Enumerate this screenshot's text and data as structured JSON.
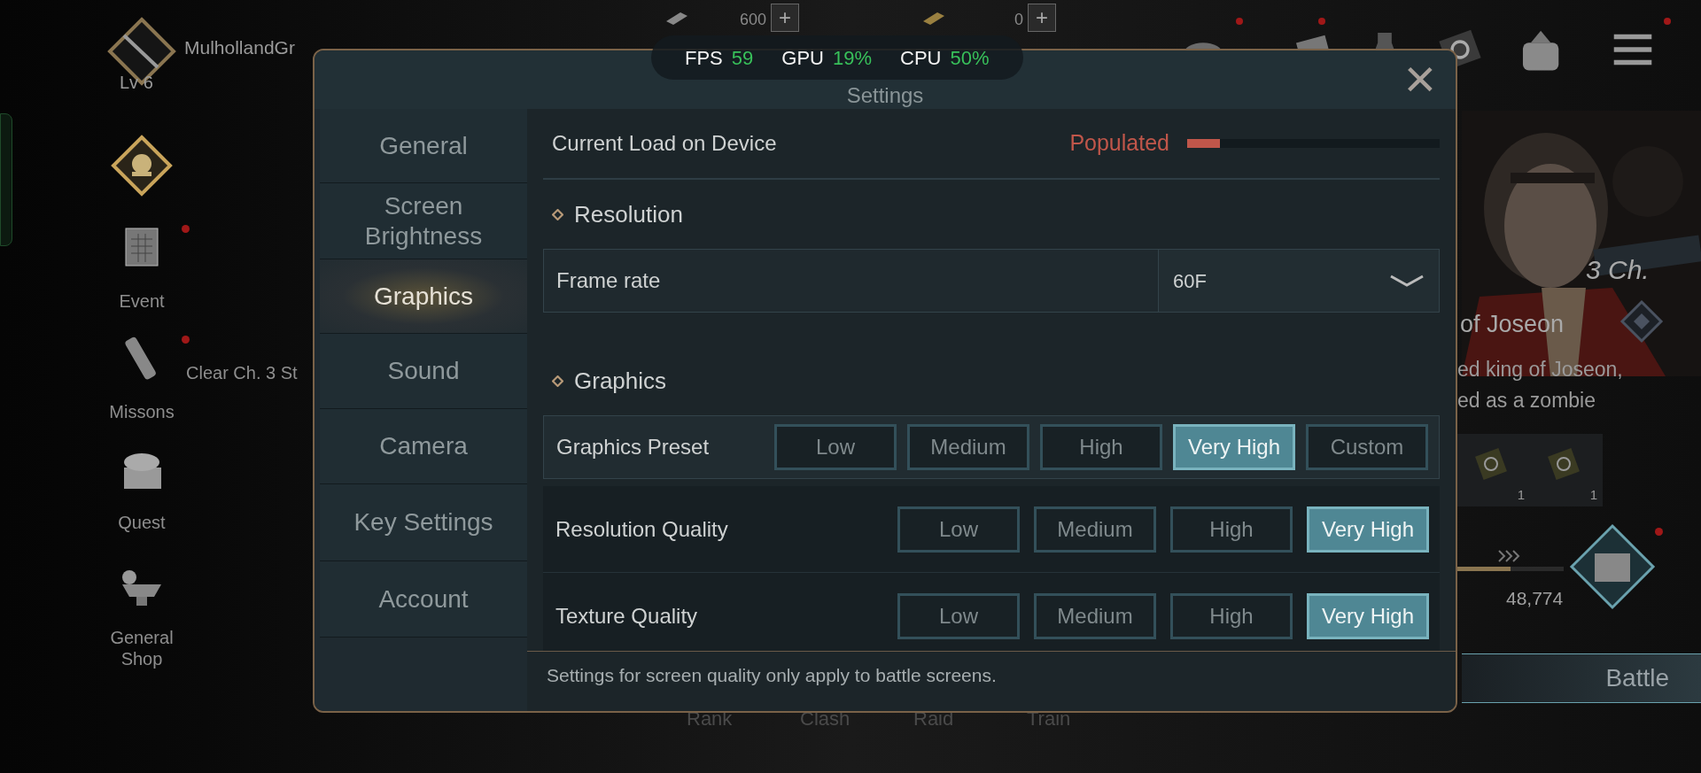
{
  "hud": {
    "player_name": "MulhollandGr",
    "level": "Lv 6",
    "resources": [
      {
        "amount": "600",
        "plus": "+"
      },
      {
        "amount": "0",
        "plus": "+"
      }
    ]
  },
  "side_menu": [
    {
      "label": "Event",
      "alert": true
    },
    {
      "label": "Missons",
      "alert": true
    },
    {
      "label": "Quest",
      "alert": false
    },
    {
      "label": "General\nShop",
      "alert": false
    }
  ],
  "quest_hint": "Clear Ch. 3 St",
  "perf": [
    {
      "label": "FPS",
      "value": "59"
    },
    {
      "label": "GPU",
      "value": "19%"
    },
    {
      "label": "CPU",
      "value": "50%"
    }
  ],
  "settings": {
    "title": "Settings",
    "close": "×",
    "nav": [
      {
        "label": "General",
        "selected": false
      },
      {
        "label": "Screen Brightness",
        "selected": false
      },
      {
        "label": "Graphics",
        "selected": true
      },
      {
        "label": "Sound",
        "selected": false
      },
      {
        "label": "Camera",
        "selected": false
      },
      {
        "label": "Key Settings",
        "selected": false
      },
      {
        "label": "Account",
        "selected": false
      }
    ],
    "load": {
      "label": "Current Load on Device",
      "status": "Populated",
      "level": 0.13
    },
    "sections": [
      {
        "kind": "heading",
        "label": "Resolution"
      },
      {
        "kind": "dropdown",
        "label": "Frame rate",
        "value": "60F"
      },
      {
        "kind": "heading",
        "label": "Graphics"
      },
      {
        "kind": "preset",
        "label": "Graphics Preset",
        "options": [
          {
            "label": "Low",
            "selected": false
          },
          {
            "label": "Medium",
            "selected": false
          },
          {
            "label": "High",
            "selected": false
          },
          {
            "label": "Very High",
            "selected": true
          },
          {
            "label": "Custom",
            "selected": false
          }
        ]
      },
      {
        "kind": "quality",
        "label": "Resolution Quality",
        "options": [
          {
            "label": "Low",
            "selected": false
          },
          {
            "label": "Medium",
            "selected": false
          },
          {
            "label": "High",
            "selected": false
          },
          {
            "label": "Very High",
            "selected": true
          }
        ]
      },
      {
        "kind": "quality",
        "label": "Texture Quality",
        "options": [
          {
            "label": "Low",
            "selected": false
          },
          {
            "label": "Medium",
            "selected": false
          },
          {
            "label": "High",
            "selected": false
          },
          {
            "label": "Very High",
            "selected": true
          }
        ]
      }
    ],
    "footer_note": "Settings for screen quality only apply to battle screens."
  },
  "background": {
    "chapter": "3 Ch.",
    "boss_name": "of Joseon",
    "boss_desc": [
      "ed king of Joseon,",
      "ed as a zombie"
    ],
    "rewards": [
      {
        "count": "1"
      },
      {
        "count": "1"
      }
    ],
    "progress": {
      "level": 0.5
    },
    "power": "48,774",
    "battle": "Battle",
    "tabs": [
      "Rank",
      "Clash",
      "Raid",
      "Train"
    ]
  }
}
